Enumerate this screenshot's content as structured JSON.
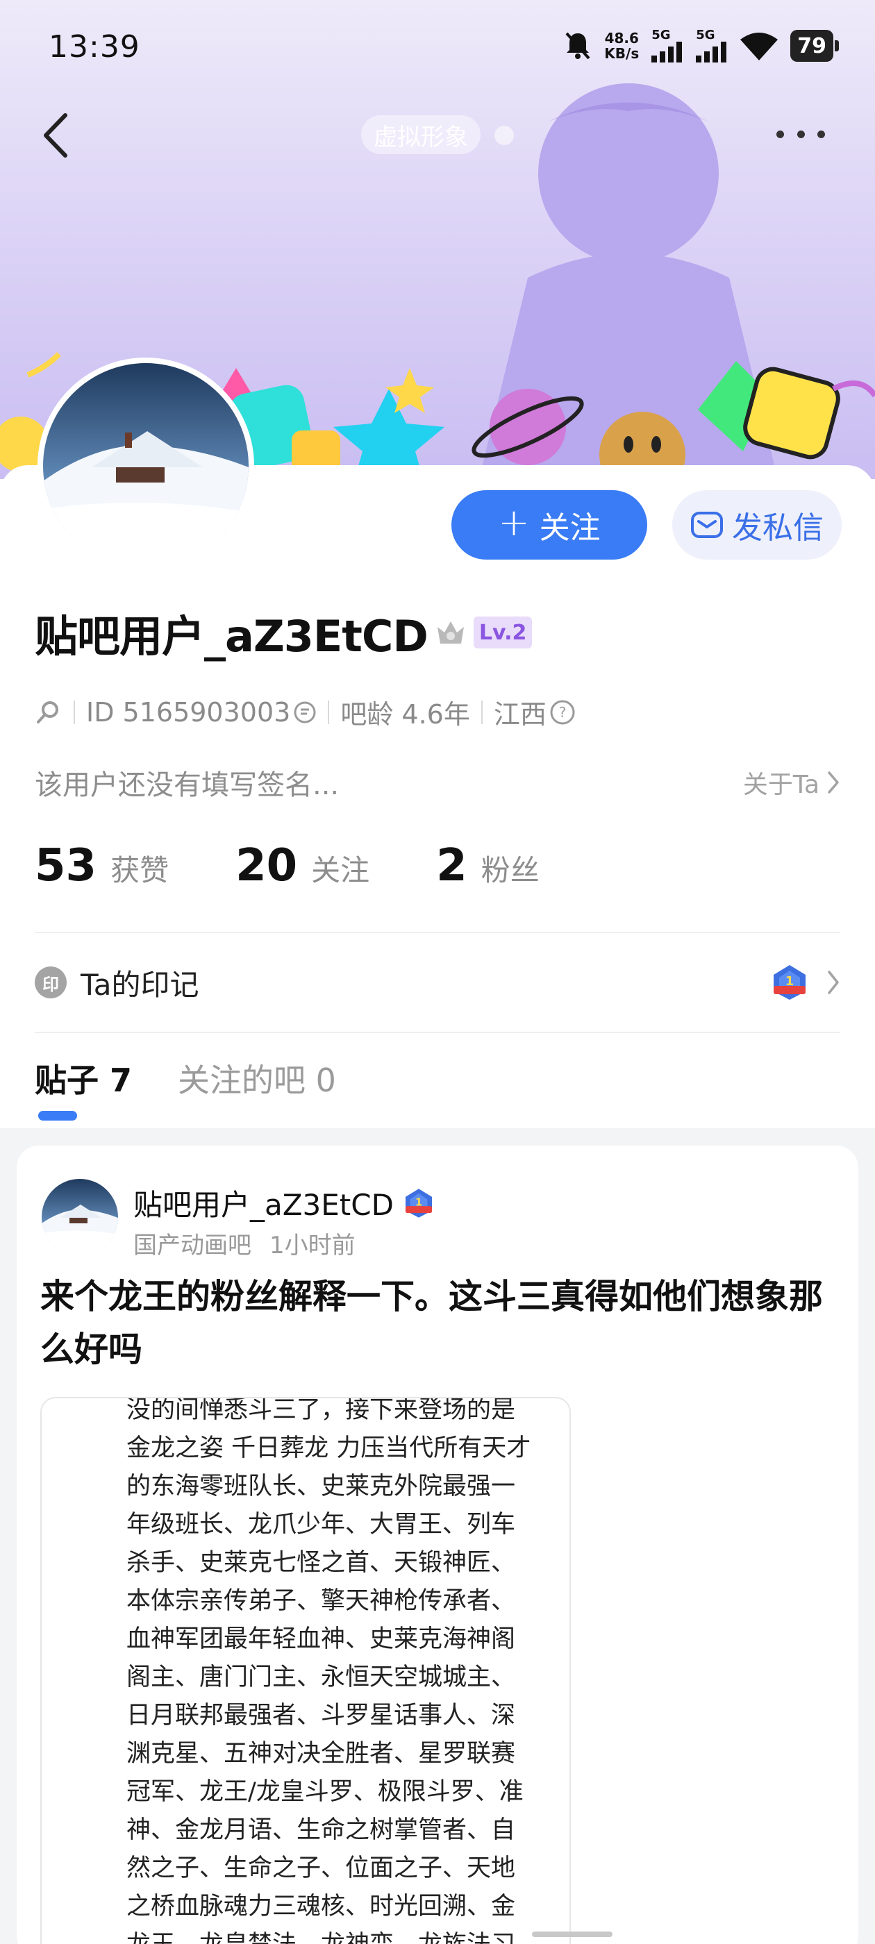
{
  "status_bar": {
    "time": "13:39",
    "net_speed_value": "48.6",
    "net_speed_unit": "KB/s",
    "sim1": "5G",
    "sim2": "5G",
    "battery": "79"
  },
  "header": {
    "virtual_avatar_label": "虚拟形象"
  },
  "actions": {
    "follow_label": "关注",
    "message_label": "发私信"
  },
  "profile": {
    "username": "贴吧用户_aZ3EtCD",
    "level": "Lv.2",
    "id_text": "ID 5165903003",
    "age_text": "吧龄 4.6年",
    "location": "江西",
    "bio": "该用户还没有填写签名...",
    "about_link": "关于Ta"
  },
  "stats": [
    {
      "value": "53",
      "label": "获赞"
    },
    {
      "value": "20",
      "label": "关注"
    },
    {
      "value": "2",
      "label": "粉丝"
    }
  ],
  "seal": {
    "icon_char": "印",
    "title": "Ta的印记"
  },
  "tabs": [
    {
      "label": "贴子 7",
      "active": true
    },
    {
      "label": "关注的吧 0",
      "active": false
    }
  ],
  "post": {
    "author": "贴吧用户_aZ3EtCD",
    "forum": "国产动画吧",
    "time": "1小时前",
    "title": "来个龙王的粉丝解释一下。这斗三真得如他们想象那么好吗",
    "image_lines": [
      "没的间惮悉斗三了，接下来登场的是",
      "金龙之姿 千日葬龙 力压当代所有天才",
      "的东海零班队长、史莱克外院最强一",
      "年级班长、龙爪少年、大胃王、列车",
      "杀手、史莱克七怪之首、天锻神匠、",
      "本体宗亲传弟子、擎天神枪传承者、",
      "血神军团最年轻血神、史莱克海神阁",
      "阁主、唐门门主、永恒天空城城主、",
      "日月联邦最强者、斗罗星话事人、深",
      "渊克星、五神对决全胜者、星罗联赛",
      "冠军、龙王/龙皇斗罗、极限斗罗、准",
      "神、金龙月语、生命之树掌管者、自",
      "然之子、生命之子、位面之子、天地",
      "之桥血脉魂力三魂核、时光回溯、金",
      "龙王、龙皇禁法、龙神变、龙族法习"
    ]
  },
  "colors": {
    "accent": "#3a7cf5",
    "level_badge_bg": "#e9dcfb",
    "level_badge_text": "#8a55e0",
    "banner_top": "#eeeaf9",
    "banner_bottom": "#c9bdf2"
  },
  "icons": [
    "bell-muted-icon",
    "wifi-icon",
    "back-arrow-icon",
    "more-icon",
    "plus-icon",
    "mail-icon",
    "crown-icon",
    "search-icon",
    "copy-icon",
    "help-icon",
    "chevron-right-icon",
    "seal-icon",
    "badge-icon"
  ]
}
